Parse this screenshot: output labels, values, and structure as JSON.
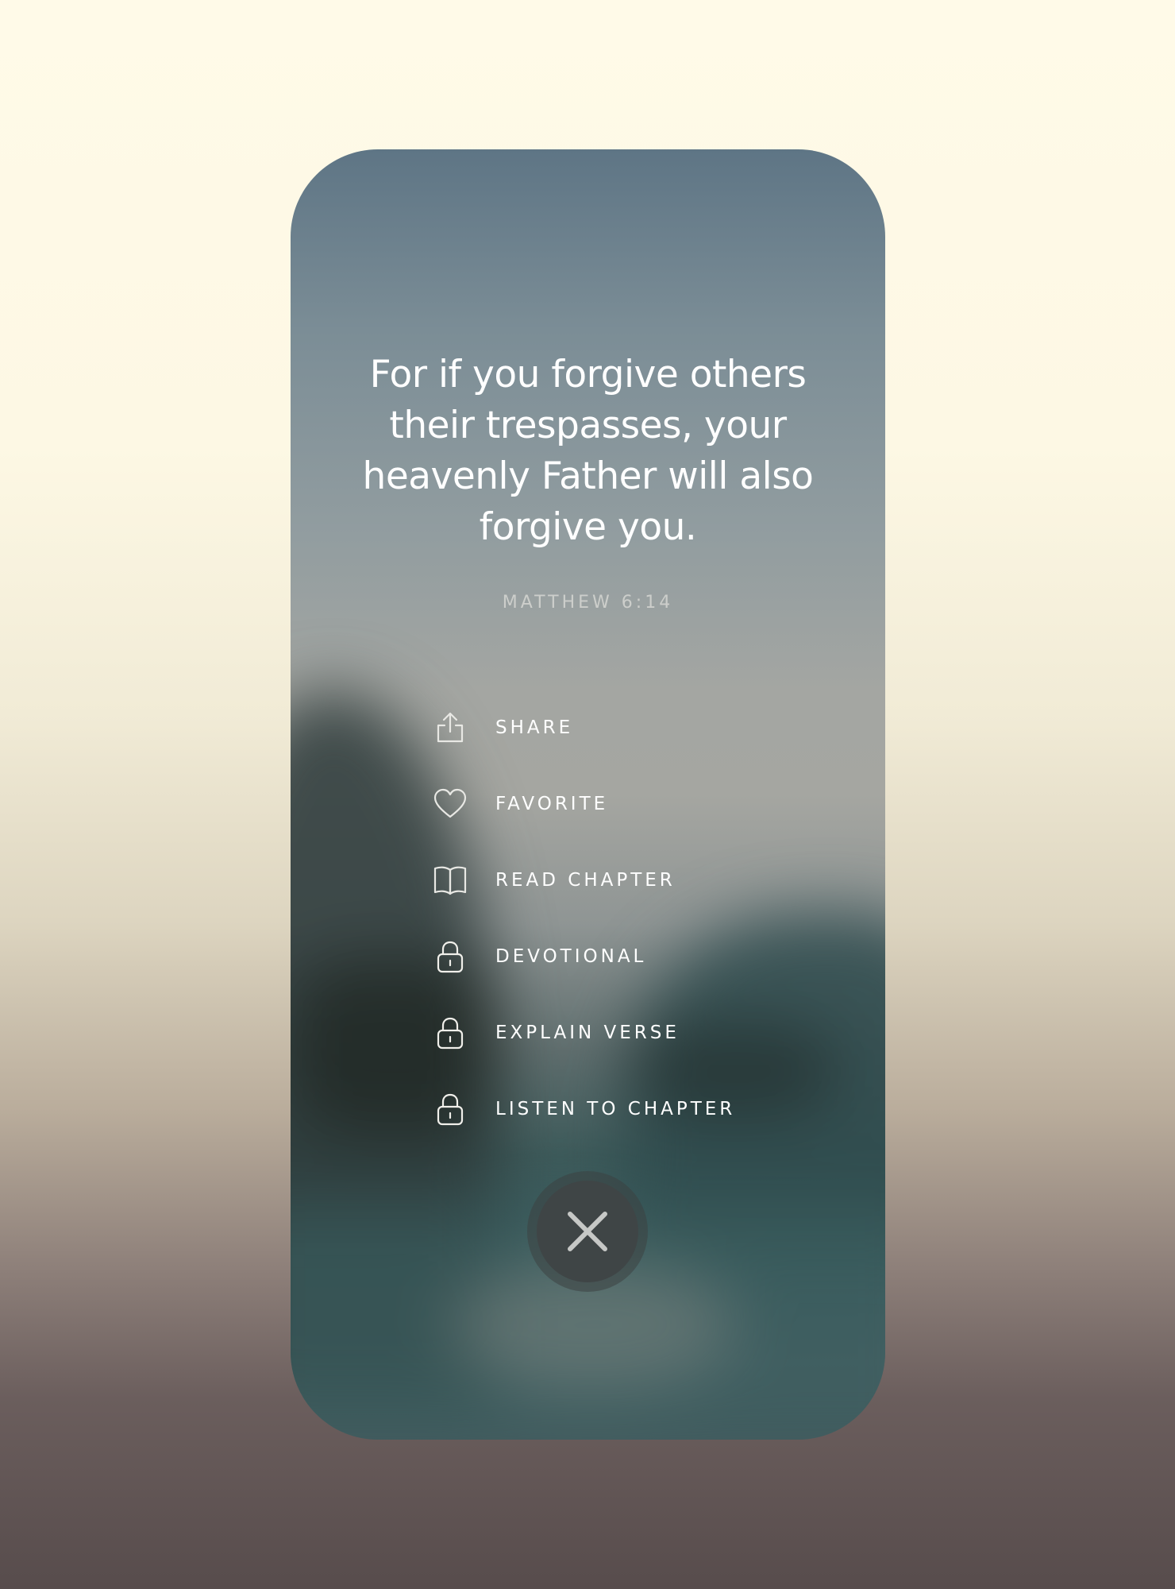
{
  "verse": {
    "text": "For if you forgive others their trespasses, your heavenly Father will also forgive you.",
    "reference": "MATTHEW 6:14"
  },
  "menu": {
    "items": [
      {
        "label": "SHARE",
        "icon": "share-icon",
        "locked": false
      },
      {
        "label": "FAVORITE",
        "icon": "heart-icon",
        "locked": false
      },
      {
        "label": "READ CHAPTER",
        "icon": "book-icon",
        "locked": false
      },
      {
        "label": "DEVOTIONAL",
        "icon": "lock-icon",
        "locked": true
      },
      {
        "label": "EXPLAIN VERSE",
        "icon": "lock-icon",
        "locked": true
      },
      {
        "label": "LISTEN TO CHAPTER",
        "icon": "lock-icon",
        "locked": true
      }
    ]
  },
  "close_button": {
    "icon": "close-icon"
  },
  "colors": {
    "text": "#ffffff",
    "reference": "#d6d7d3",
    "close_background": "#3f4546",
    "page_background_top": "#fffae8",
    "page_background_bottom": "#574c4c"
  }
}
